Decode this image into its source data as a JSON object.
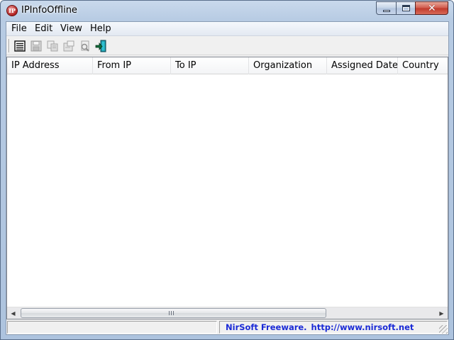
{
  "window": {
    "title": "IPInfoOffline",
    "icon_text": "IP",
    "controls": {
      "minimize": "minimize-icon",
      "maximize": "maximize-icon",
      "close": "✕"
    }
  },
  "menu": {
    "items": [
      {
        "label": "File"
      },
      {
        "label": "Edit"
      },
      {
        "label": "View"
      },
      {
        "label": "Help"
      }
    ]
  },
  "toolbar": {
    "buttons": [
      {
        "icon": "properties-icon"
      },
      {
        "icon": "save-icon"
      },
      {
        "icon": "copy-icon"
      },
      {
        "icon": "html-report-icon"
      },
      {
        "icon": "find-icon"
      },
      {
        "icon": "exit-icon"
      }
    ]
  },
  "list": {
    "columns": [
      {
        "label": "IP Address"
      },
      {
        "label": "From IP"
      },
      {
        "label": "To IP"
      },
      {
        "label": "Organization"
      },
      {
        "label": "Assigned Date"
      },
      {
        "label": "Country"
      }
    ],
    "rows": [],
    "scrollbar_glyph": "Ⅲ"
  },
  "status": {
    "left": "",
    "brand": "NirSoft Freeware.",
    "url": "http://www.nirsoft.net",
    "link_color": "#1a2ad6"
  },
  "colors": {
    "titlebar": "#b7cbe3",
    "close_button": "#c0392b"
  }
}
